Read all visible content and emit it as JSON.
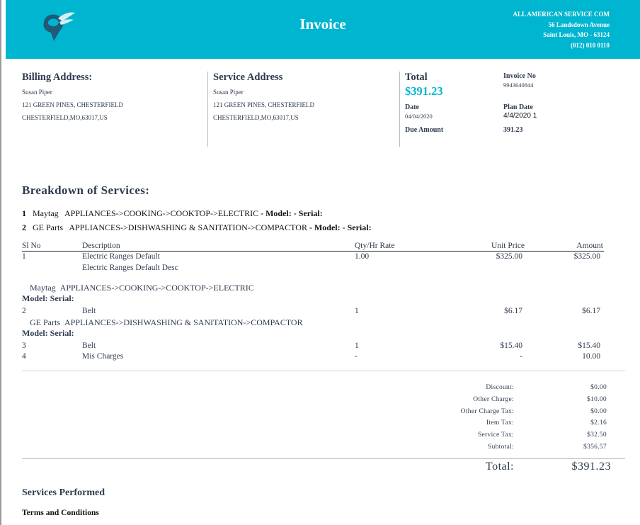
{
  "header": {
    "title": "Invoice",
    "company": {
      "name": "ALL AMERICAN SERVICE COM",
      "street": "56 Landsdown Avenue",
      "city": "Saint Louis, MO - 63124",
      "phone": "(012) 010 0110"
    },
    "accent_color": "#00b5cf"
  },
  "billing": {
    "heading": "Billing Address:",
    "name": "Susan Piper",
    "line1": "121 GREEN PINES, CHESTERFIELD",
    "line2": "CHESTERFIELD,MO,63017,US"
  },
  "service_address": {
    "heading": "Service Address",
    "name": "Susan Piper",
    "line1": "121 GREEN PINES, CHESTERFIELD",
    "line2": "CHESTERFIELD,MO,63017,US"
  },
  "summary": {
    "total_label": "Total",
    "total_value": "$391.23",
    "invoice_no_label": "Invoice No",
    "invoice_no": "9943640844",
    "date_label": "Date",
    "date": "04/04/2020",
    "plan_date_label": "Plan Date",
    "plan_date": "4/4/2020 1",
    "due_label": "Due Amount",
    "due_value": "391.23"
  },
  "breakdown": {
    "heading": "Breakdown of Services:",
    "entries": [
      {
        "num": "1",
        "brand": "Maytag",
        "path": "APPLIANCES->COOKING->COOKTOP->ELECTRIC",
        "model_serial": "- Model: - Serial:"
      },
      {
        "num": "2",
        "brand": "GE Parts",
        "path": "APPLIANCES->DISHWASHING & SANITATION->COMPACTOR",
        "model_serial": "- Model: - Serial:"
      }
    ]
  },
  "table": {
    "headers": {
      "sl": "Sl No",
      "desc": "Description",
      "qty": "Qty/Hr Rate",
      "unit": "Unit Price",
      "amount": "Amount"
    },
    "row1": {
      "sl": "1",
      "desc": "Electric Ranges Default",
      "desc2": "Electric Ranges Default Desc",
      "qty": "1.00",
      "unit": "$325.00",
      "amount": "$325.00"
    },
    "group1": {
      "brand": "Maytag",
      "path": "APPLIANCES->COOKING->COOKTOP->ELECTRIC",
      "model": "Model: Serial:"
    },
    "row2": {
      "sl": "2",
      "desc": "Belt",
      "qty": "1",
      "unit": "$6.17",
      "amount": "$6.17"
    },
    "group2": {
      "brand": "GE Parts",
      "path": "APPLIANCES->DISHWASHING & SANITATION->COMPACTOR",
      "model": "Model: Serial:"
    },
    "row3": {
      "sl": "3",
      "desc": "Belt",
      "qty": "1",
      "unit": "$15.40",
      "amount": "$15.40"
    },
    "row4": {
      "sl": "4",
      "desc": "Mis Charges",
      "qty": "-",
      "unit": "-",
      "amount": "10.00"
    }
  },
  "totals": {
    "discount_label": "Discount:",
    "discount": "$0.00",
    "other_charge_label": "Other Charge:",
    "other_charge": "$10.00",
    "other_charge_tax_label": "Other Charge Tax:",
    "other_charge_tax": "$0.00",
    "item_tax_label": "Item Tax:",
    "item_tax": "$2.16",
    "service_tax_label": "Service Tax:",
    "service_tax": "$32.50",
    "subtotal_label": "Subtotal:",
    "subtotal": "$356.57",
    "total_label": "Total:",
    "total": "$391.23"
  },
  "footer": {
    "services_performed": "Services Performed",
    "terms": "Terms and Conditions"
  }
}
